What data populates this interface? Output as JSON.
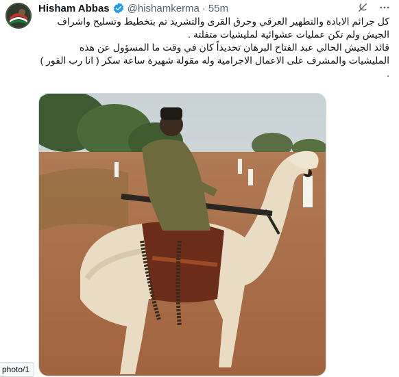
{
  "author": {
    "name": "Hisham Abbas",
    "handle": "@hishamkerma",
    "time": "55m",
    "separator": "·"
  },
  "icons": {
    "verified": "verified-badge-icon",
    "grok": "grok-icon",
    "more": "more-options-icon"
  },
  "tweet": {
    "lines": [
      "كل جرائم الابادة والتطهير العرقي وحرق القرى والتشريد تم بتخطيط وتسليح واشراف",
      "الجيش ولم تكن عمليات عشوائية لمليشيات متفلتة .",
      "قائد الجيش الحالي عبد الفتاح البرهان تحديداً كان في وقت ما المسؤول عن هذه",
      "المليشيات والمشرف على الاعمال الاجرامية وله مقولة شهيرة ساعة سكر ( انا رب الفور )",
      "."
    ]
  },
  "media": {
    "badge": "photo/1"
  },
  "colors": {
    "verified": "#1d9bf0",
    "muted": "#536471",
    "text": "#0f1419"
  }
}
